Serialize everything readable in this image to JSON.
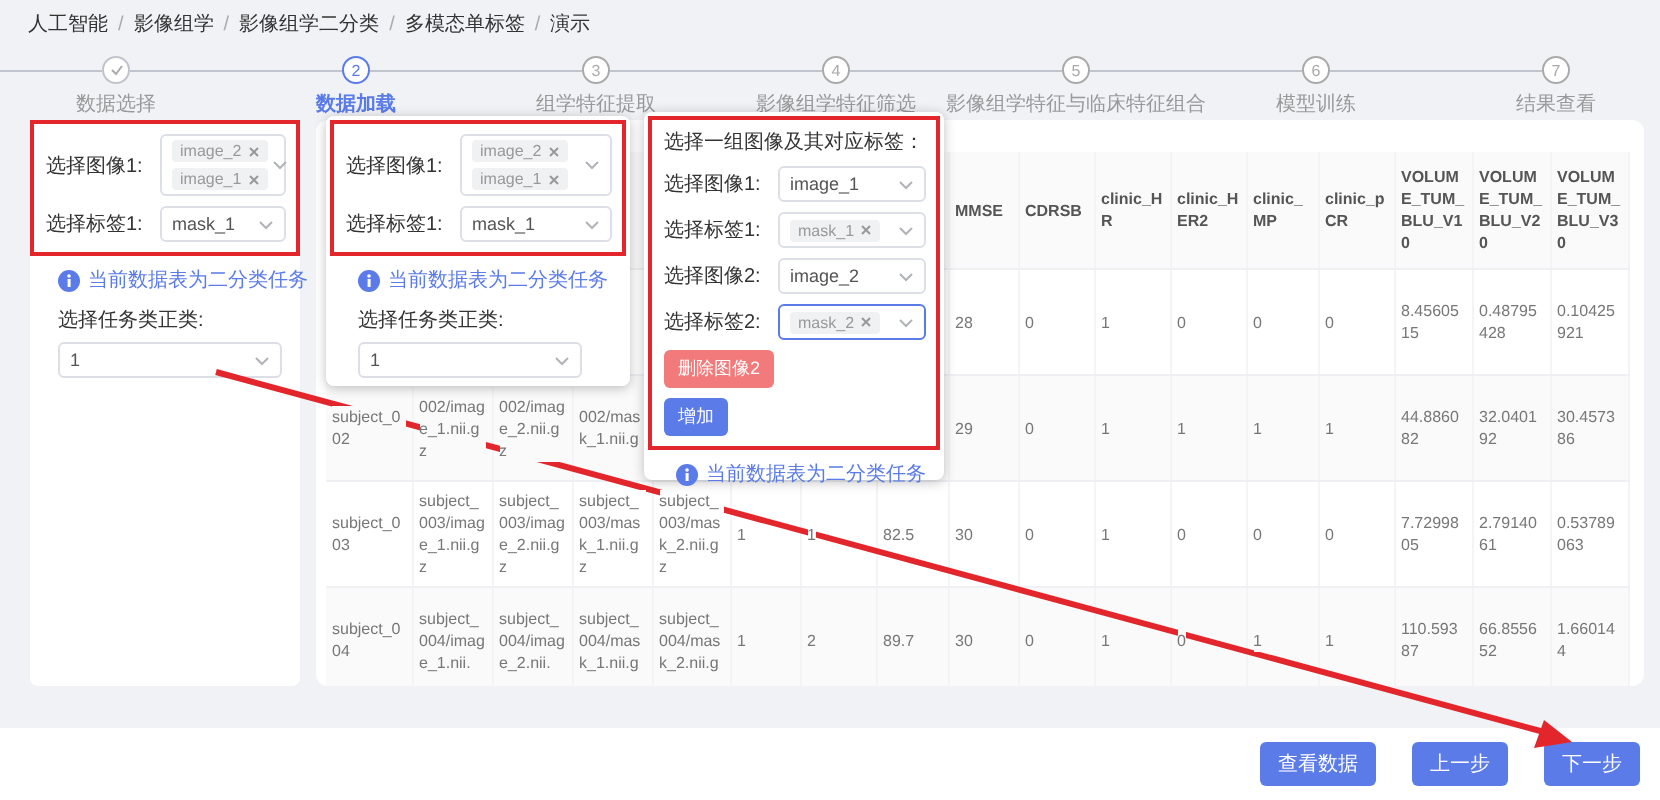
{
  "breadcrumb": [
    {
      "label": "人工智能",
      "separator": "/"
    },
    {
      "label": "影像组学",
      "separator": "/"
    },
    {
      "label": "影像组学二分类",
      "separator": "/"
    },
    {
      "label": "多模态单标签",
      "separator": "/"
    },
    {
      "label": "演示"
    }
  ],
  "steps": [
    {
      "label": "数据选择",
      "done": true,
      "selected": false
    },
    {
      "number": "2",
      "label": "数据加载",
      "done": false,
      "selected": true
    },
    {
      "number": "3",
      "label": "组学特征提取",
      "done": false,
      "selected": false
    },
    {
      "number": "4",
      "label": "影像组学特征筛选",
      "done": false,
      "selected": false
    },
    {
      "number": "5",
      "label": "影像组学特征与临床特征组合",
      "done": false,
      "selected": false
    },
    {
      "number": "6",
      "label": "模型训练",
      "done": false,
      "selected": false
    },
    {
      "number": "7",
      "label": "结果查看",
      "done": false,
      "selected": false
    }
  ],
  "left_panel": {
    "fields": [
      {
        "kind": "multi",
        "label": "选择图像1:",
        "tags": [
          "image_2",
          "image_1"
        ]
      },
      {
        "kind": "select",
        "label": "选择标签1:",
        "value": "mask_1"
      }
    ],
    "info": "当前数据表为二分类任务",
    "positive_class": {
      "label": "选择任务类正类:",
      "value": "1"
    }
  },
  "popup_1": {
    "fields": [
      {
        "kind": "multi",
        "label": "选择图像1:",
        "tags": [
          "image_2",
          "image_1"
        ]
      },
      {
        "kind": "select",
        "label": "选择标签1:",
        "value": "mask_1"
      }
    ],
    "info": "当前数据表为二分类任务",
    "positive_class": {
      "label": "选择任务类正类:",
      "value": "1"
    }
  },
  "popup_2": {
    "title": "选择一组图像及其对应标签：",
    "fields": [
      {
        "kind": "select",
        "label": "选择图像1:",
        "value": "image_1",
        "focused": false
      },
      {
        "kind": "multi",
        "label": "选择标签1:",
        "tags": [
          "mask_1"
        ],
        "focused": false
      },
      {
        "kind": "select",
        "label": "选择图像2:",
        "value": "image_2",
        "focused": false
      },
      {
        "kind": "multi",
        "label": "选择标签2:",
        "tags": [
          "mask_2"
        ],
        "focused": true
      }
    ],
    "buttons": [
      {
        "label": "删除图像2",
        "kind": "danger"
      },
      {
        "label": "增加",
        "kind": "primary"
      }
    ],
    "info": "当前数据表为二分类任务"
  },
  "table": {
    "columns": [
      null,
      null,
      null,
      null,
      null,
      null,
      null,
      null,
      "MMSE",
      "CDRSB",
      "clinic_HR",
      "clinic_HER2",
      "clinic_MP",
      "clinic_pCR",
      "VOLUME_TUM_BLU_V10",
      "VOLUME_TUM_BLU_V20",
      "VOLUME_TUM_BLU_V30"
    ],
    "rows": [
      {
        "cells": [
          null,
          null,
          null,
          null,
          null,
          null,
          null,
          null,
          "28",
          "0",
          "1",
          "0",
          "0",
          "0",
          "8.4560515",
          "0.48795428",
          "0.10425921"
        ]
      },
      {
        "cells": [
          "subject_002",
          "002/image_1.nii.gz",
          "002/image_2.nii.gz",
          "002/mask_1.nii.g",
          null,
          null,
          null,
          null,
          "29",
          "0",
          "1",
          "1",
          "1",
          "1",
          "44.886082",
          "32.040192",
          "30.457386"
        ]
      },
      {
        "cells": [
          "subject_003",
          "subject_003/image_1.nii.gz",
          "subject_003/image_2.nii.gz",
          "subject_003/mask_1.nii.gz",
          "subject_003/mask_2.nii.gz",
          "1",
          "1",
          "82.5",
          "30",
          "0",
          "1",
          "0",
          "0",
          "0",
          "7.7299805",
          "2.7914061",
          "0.53789063"
        ]
      },
      {
        "cells": [
          "subject_004",
          "subject_004/image_1.nii.",
          "subject_004/image_2.nii.",
          "subject_004/mask_1.nii.g",
          "subject_004/mask_2.nii.g",
          "1",
          "2",
          "89.7",
          "30",
          "0",
          "1",
          "0",
          "1",
          "1",
          "110.59387",
          "66.855652",
          "1.660144"
        ]
      }
    ]
  },
  "footer_buttons": [
    "查看数据",
    "上一步",
    "下一步"
  ]
}
